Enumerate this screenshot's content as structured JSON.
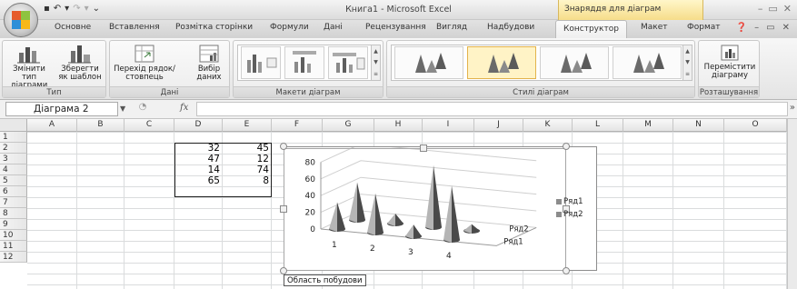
{
  "window": {
    "title": "Книга1 - Microsoft Excel",
    "context_group": "Знаряддя для діаграм",
    "controls": [
      "–",
      "▭",
      "✕"
    ]
  },
  "tabs": [
    {
      "label": "Основне"
    },
    {
      "label": "Вставлення"
    },
    {
      "label": "Розмітка сторінки"
    },
    {
      "label": "Формули"
    },
    {
      "label": "Дані"
    },
    {
      "label": "Рецензування"
    },
    {
      "label": "Вигляд"
    },
    {
      "label": "Надбудови"
    },
    {
      "label": "Конструктор"
    },
    {
      "label": "Макет"
    },
    {
      "label": "Формат"
    }
  ],
  "active_tab": "Конструктор",
  "ribbon": {
    "groups": {
      "type": "Тип",
      "data": "Дані",
      "layouts": "Макети діаграм",
      "styles": "Стилі діаграм",
      "location": "Розташування"
    },
    "buttons": {
      "change_type": "Змінити тип діаграми",
      "save_template": "Зберегти як шаблон",
      "switch_row_col": "Перехід рядок/стовпець",
      "select_data": "Вибір даних",
      "move_chart": "Перемістити діаграму"
    }
  },
  "formula_bar": {
    "name_box": "Діаграма 2",
    "fx": "fx",
    "formula": ""
  },
  "columns": [
    "A",
    "B",
    "C",
    "D",
    "E",
    "F",
    "G",
    "H",
    "I",
    "J",
    "K",
    "L",
    "M",
    "N",
    "O"
  ],
  "rows": [
    "1",
    "2",
    "3",
    "4",
    "5",
    "6",
    "7",
    "8",
    "9",
    "10",
    "11",
    "12"
  ],
  "cells": {
    "D2": "32",
    "E2": "45",
    "D3": "47",
    "E3": "12",
    "D4": "14",
    "E4": "74",
    "D5": "65",
    "E5": "8"
  },
  "tooltip": "Область побудови",
  "chart_data": {
    "type": "3d-cone",
    "categories": [
      "1",
      "2",
      "3",
      "4"
    ],
    "series": [
      {
        "name": "Ряд1",
        "values": [
          32,
          47,
          14,
          65
        ]
      },
      {
        "name": "Ряд2",
        "values": [
          45,
          12,
          74,
          8
        ]
      }
    ],
    "yticks": [
      "0",
      "20",
      "40",
      "60",
      "80"
    ],
    "depth_labels": [
      "Ряд2",
      "Ряд1"
    ],
    "legend": [
      "Ряд1",
      "Ряд2"
    ],
    "legend_position": "right",
    "ylim": [
      0,
      80
    ],
    "colors": {
      "cone": "#7a7a7a",
      "cone_light": "#b5b5b5",
      "cone_dark": "#4a4a4a"
    }
  }
}
